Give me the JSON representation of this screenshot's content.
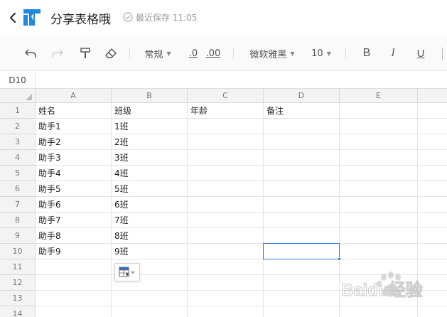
{
  "titlebar": {
    "doc_title": "分享表格哦",
    "save_status": "最近保存 11:05"
  },
  "toolbar": {
    "number_format": "常规",
    "decrease_decimal": ".0",
    "increase_decimal": ".00",
    "font_family": "微软雅黑",
    "font_size": "10",
    "bold": "B",
    "italic": "I",
    "underline": "U"
  },
  "formula": {
    "cell_ref": "D10"
  },
  "sheet": {
    "columns": [
      "A",
      "B",
      "C",
      "D",
      "E"
    ],
    "rows": [
      "1",
      "2",
      "3",
      "4",
      "5",
      "6",
      "7",
      "8",
      "9",
      "10",
      "11",
      "12",
      "13",
      "14"
    ],
    "cells": [
      [
        "姓名",
        "班级",
        "年龄",
        "备注",
        ""
      ],
      [
        "助手1",
        "1班",
        "",
        "",
        ""
      ],
      [
        "助手2",
        "2班",
        "",
        "",
        ""
      ],
      [
        "助手3",
        "3班",
        "",
        "",
        ""
      ],
      [
        "助手4",
        "4班",
        "",
        "",
        ""
      ],
      [
        "助手5",
        "5班",
        "",
        "",
        ""
      ],
      [
        "助手6",
        "6班",
        "",
        "",
        ""
      ],
      [
        "助手7",
        "7班",
        "",
        "",
        ""
      ],
      [
        "助手8",
        "8班",
        "",
        "",
        ""
      ],
      [
        "助手9",
        "9班",
        "",
        "",
        ""
      ],
      [
        "",
        "",
        "",
        "",
        ""
      ],
      [
        "",
        "",
        "",
        "",
        ""
      ],
      [
        "",
        "",
        "",
        "",
        ""
      ],
      [
        "",
        "",
        "",
        "",
        ""
      ]
    ],
    "selected_cell": "D10"
  },
  "colors": {
    "accent": "#2b7be6",
    "logo": "#1e88e5"
  },
  "watermark": {
    "text": "Baidu经验",
    "icon": "paw-icon"
  }
}
